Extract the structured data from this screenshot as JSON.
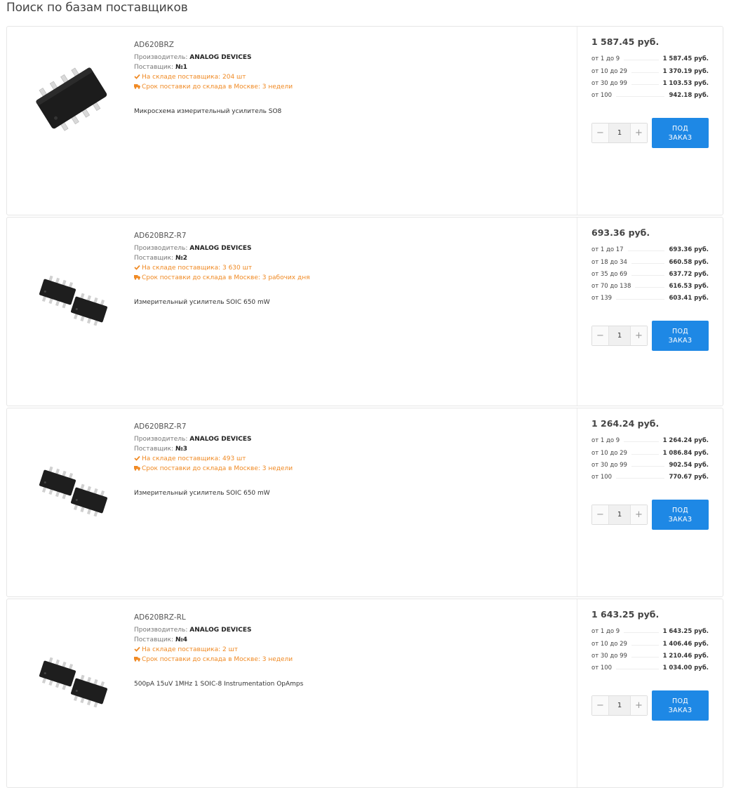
{
  "page_title": "Поиск по базам поставщиков",
  "labels": {
    "manufacturer": "Производитель:",
    "supplier": "Поставщик:",
    "order_button_line1": "ПОД",
    "order_button_line2": "ЗАКАЗ",
    "minus": "−",
    "plus": "+"
  },
  "colors": {
    "accent": "#1e88e5",
    "stock": "#f08a24"
  },
  "products": [
    {
      "name": "AD620BRZ",
      "manufacturer": "ANALOG DEVICES",
      "supplier": "№1",
      "stock": "На складе поставщика: 204 шт",
      "delivery": "Срок поставки до склада в Москве: 3 недели",
      "description": "Микросхема измерительный усилитель SO8",
      "price": "1 587.45 руб.",
      "tiers": [
        {
          "range": "от 1 до 9",
          "price": "1 587.45 руб."
        },
        {
          "range": "от 10 до 29",
          "price": "1 370.19 руб."
        },
        {
          "range": "от 30 до 99",
          "price": "1 103.53 руб."
        },
        {
          "range": "от 100",
          "price": "942.18 руб."
        }
      ],
      "qty": "1"
    },
    {
      "name": "AD620BRZ-R7",
      "manufacturer": "ANALOG DEVICES",
      "supplier": "№2",
      "stock": "На складе поставщика: 3 630 шт",
      "delivery": "Срок поставки до склада в Москве: 3 рабочих дня",
      "description": "Измерительный усилитель SOIC 650 mW",
      "price": "693.36 руб.",
      "tiers": [
        {
          "range": "от 1 до 17",
          "price": "693.36 руб."
        },
        {
          "range": "от 18 до 34",
          "price": "660.58 руб."
        },
        {
          "range": "от 35 до 69",
          "price": "637.72 руб."
        },
        {
          "range": "от 70 до 138",
          "price": "616.53 руб."
        },
        {
          "range": "от 139",
          "price": "603.41 руб."
        }
      ],
      "qty": "1"
    },
    {
      "name": "AD620BRZ-R7",
      "manufacturer": "ANALOG DEVICES",
      "supplier": "№3",
      "stock": "На складе поставщика: 493 шт",
      "delivery": "Срок поставки до склада в Москве: 3 недели",
      "description": "Измерительный усилитель SOIC 650 mW",
      "price": "1 264.24 руб.",
      "tiers": [
        {
          "range": "от 1 до 9",
          "price": "1 264.24 руб."
        },
        {
          "range": "от 10 до 29",
          "price": "1 086.84 руб."
        },
        {
          "range": "от 30 до 99",
          "price": "902.54 руб."
        },
        {
          "range": "от 100",
          "price": "770.67 руб."
        }
      ],
      "qty": "1"
    },
    {
      "name": "AD620BRZ-RL",
      "manufacturer": "ANALOG DEVICES",
      "supplier": "№4",
      "stock": "На складе поставщика: 2 шт",
      "delivery": "Срок поставки до склада в Москве: 3 недели",
      "description": "500pA 15uV 1MHz 1 SOIC-8 Instrumentation OpAmps",
      "price": "1 643.25 руб.",
      "tiers": [
        {
          "range": "от 1 до 9",
          "price": "1 643.25 руб."
        },
        {
          "range": "от 10 до 29",
          "price": "1 406.46 руб."
        },
        {
          "range": "от 30 до 99",
          "price": "1 210.46 руб."
        },
        {
          "range": "от 100",
          "price": "1 034.00 руб."
        }
      ],
      "qty": "1"
    }
  ]
}
